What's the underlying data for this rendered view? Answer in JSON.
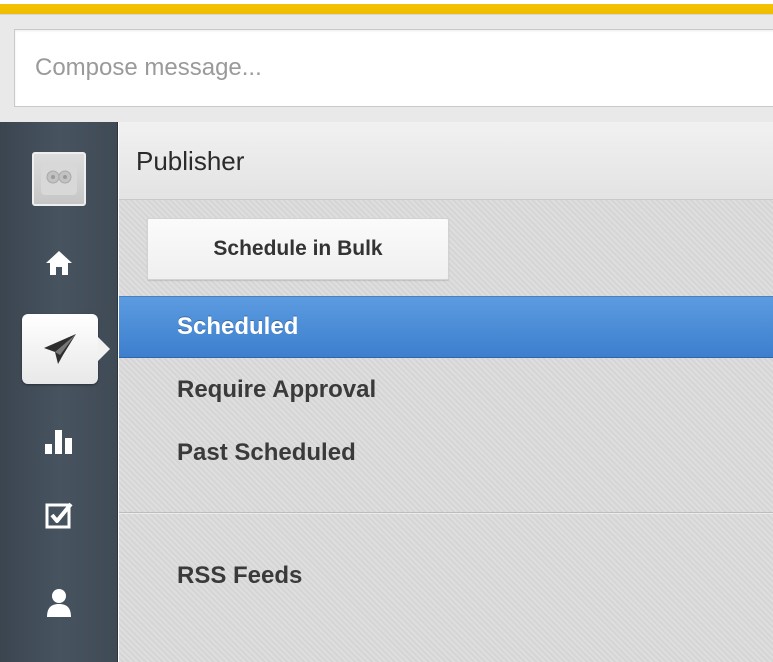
{
  "compose": {
    "placeholder": "Compose message..."
  },
  "sidebar": {
    "icons": [
      {
        "name": "avatar",
        "active": false
      },
      {
        "name": "home-icon",
        "active": false
      },
      {
        "name": "send-icon",
        "active": true
      },
      {
        "name": "analytics-icon",
        "active": false
      },
      {
        "name": "assignments-icon",
        "active": false
      },
      {
        "name": "contacts-icon",
        "active": false
      }
    ]
  },
  "publisher": {
    "title": "Publisher",
    "bulk_button": "Schedule in Bulk",
    "nav": [
      {
        "label": "Scheduled",
        "active": true
      },
      {
        "label": "Require Approval",
        "active": false
      },
      {
        "label": "Past Scheduled",
        "active": false
      }
    ],
    "feeds": {
      "label": "RSS Feeds"
    }
  },
  "colors": {
    "accent_yellow": "#f3c300",
    "sidebar_dark": "#3f4a55",
    "active_blue": "#4a8cd8"
  }
}
